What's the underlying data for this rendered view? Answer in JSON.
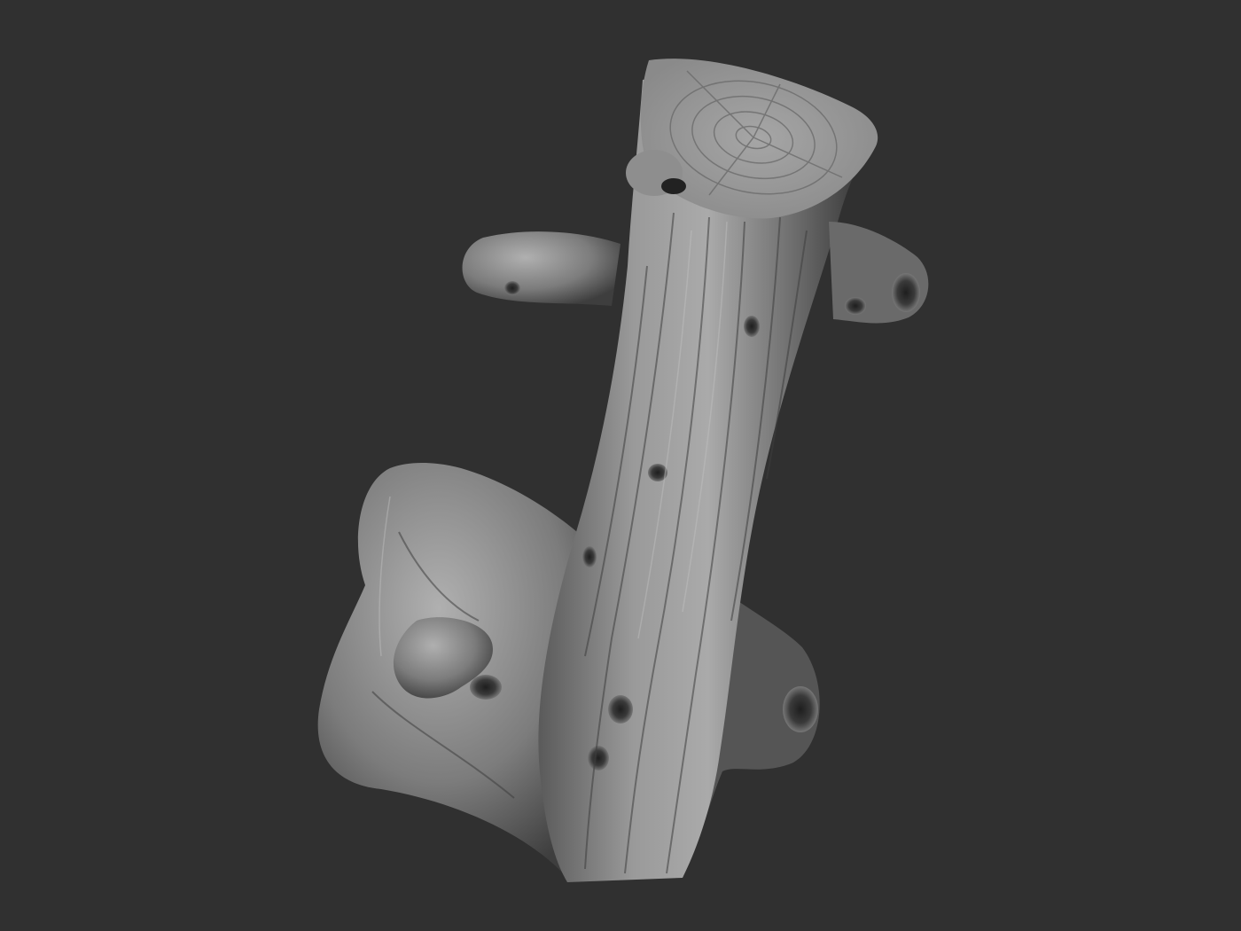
{
  "scene": {
    "background_color": "#303030",
    "subject": "sculpted-tree-stump",
    "material_color": "#8a8a8a",
    "highlight_color": "#bdbdbd",
    "shadow_color": "#1c1c1c"
  }
}
